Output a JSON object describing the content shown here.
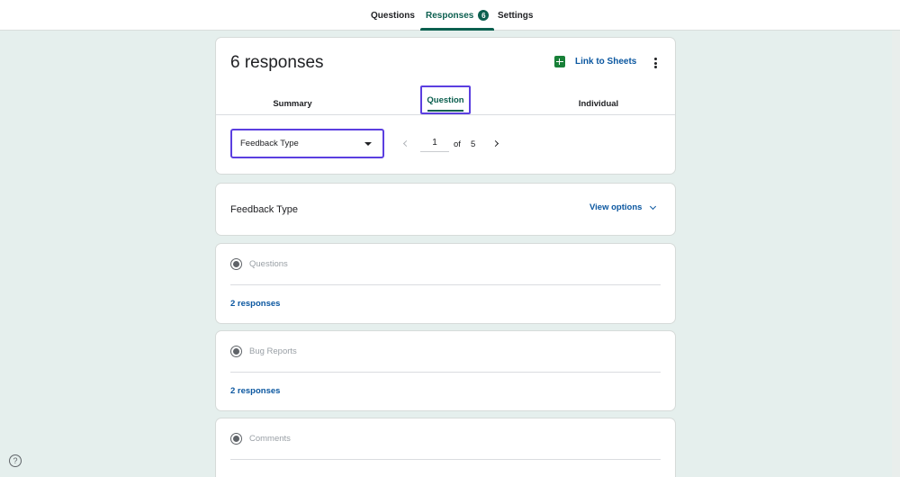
{
  "topnav": {
    "tabs": [
      {
        "label": "Questions"
      },
      {
        "label": "Responses",
        "badge": "6",
        "active": true
      },
      {
        "label": "Settings"
      }
    ]
  },
  "summary": {
    "title": "6 responses",
    "sheets_link": "Link to Sheets",
    "subtabs": [
      {
        "label": "Summary"
      },
      {
        "label": "Question",
        "active": true
      },
      {
        "label": "Individual"
      }
    ],
    "question_select": {
      "value": "Feedback Type"
    },
    "pager": {
      "current": "1",
      "of": "of",
      "total": "5"
    }
  },
  "question": {
    "title": "Feedback Type",
    "view_options": "View options"
  },
  "options": [
    {
      "label": "Questions",
      "count": "2 responses"
    },
    {
      "label": "Bug Reports",
      "count": "2 responses"
    },
    {
      "label": "Comments"
    }
  ],
  "colors": {
    "accent": "#0b5f4f",
    "link": "#0b57a0",
    "focus": "#5b3fe0",
    "background": "#e5efed"
  },
  "icons": [
    "sheets-icon",
    "more-vert-icon",
    "dropdown-caret-icon",
    "chevron-left-icon",
    "chevron-right-icon",
    "chevron-down-icon",
    "radio-icon",
    "help-icon"
  ]
}
